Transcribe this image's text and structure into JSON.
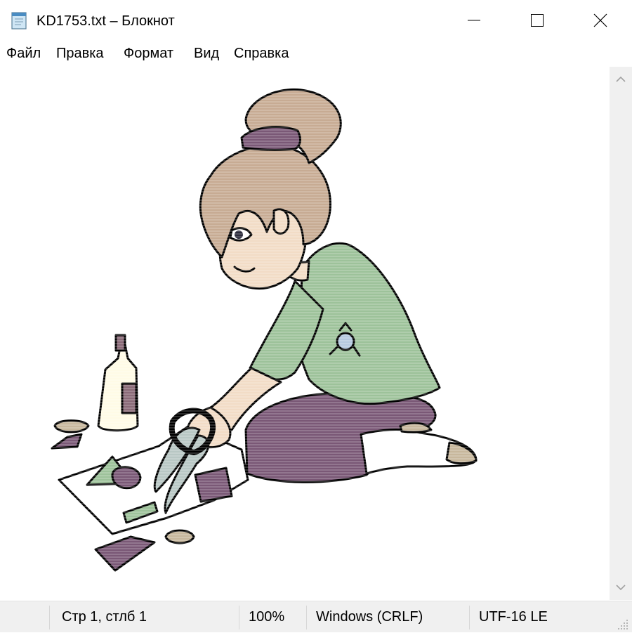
{
  "window": {
    "title": "KD1753.txt – Блокнот",
    "icons": {
      "app": "notepad-icon",
      "minimize": "minimize-icon",
      "maximize": "maximize-icon",
      "close": "close-icon"
    }
  },
  "menu": {
    "items": [
      {
        "label": "Файл"
      },
      {
        "label": "Правка"
      },
      {
        "label": "Формат"
      },
      {
        "label": "Вид"
      },
      {
        "label": "Справка"
      }
    ]
  },
  "status": {
    "position": "Стр 1, стлб 1",
    "zoom": "100%",
    "line_endings": "Windows (CRLF)",
    "encoding": "UTF-16 LE"
  },
  "colors": {
    "hair": "#c7ab93",
    "skin": "#f2dcc6",
    "shirt": "#9dc29a",
    "pants": "#7a5876",
    "bottle": "#fffbe6",
    "label": "#8a6a78",
    "outline": "#000000",
    "scrollbar_bg": "#f0f0f0",
    "statusbar_bg": "#f0f0f0"
  }
}
